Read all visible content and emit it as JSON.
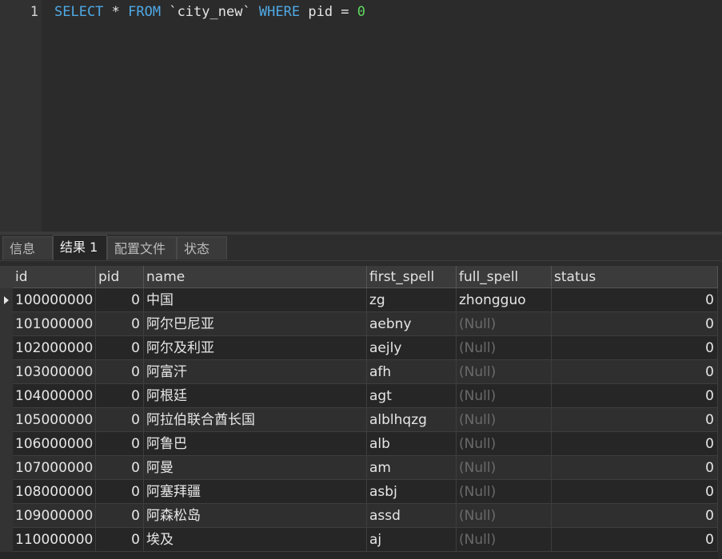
{
  "editor": {
    "line_number": "1",
    "tokens": {
      "select": "SELECT",
      "star": " * ",
      "from": "FROM",
      "table": " `city_new` ",
      "where": "WHERE",
      "cond": " pid = ",
      "value": "0"
    }
  },
  "tabs": [
    {
      "label": "信息",
      "active": false
    },
    {
      "label": "结果 1",
      "active": true
    },
    {
      "label": "配置文件",
      "active": false
    },
    {
      "label": "状态",
      "active": false
    }
  ],
  "grid": {
    "columns": [
      "id",
      "pid",
      "name",
      "first_spell",
      "full_spell",
      "status"
    ],
    "rows": [
      {
        "id": "100000000",
        "pid": "0",
        "name": "中国",
        "first_spell": "zg",
        "full_spell": "zhongguo",
        "status": "0"
      },
      {
        "id": "101000000",
        "pid": "0",
        "name": "阿尔巴尼亚",
        "first_spell": "aebny",
        "full_spell": "(Null)",
        "status": "0"
      },
      {
        "id": "102000000",
        "pid": "0",
        "name": "阿尔及利亚",
        "first_spell": "aejly",
        "full_spell": "(Null)",
        "status": "0"
      },
      {
        "id": "103000000",
        "pid": "0",
        "name": "阿富汗",
        "first_spell": "afh",
        "full_spell": "(Null)",
        "status": "0"
      },
      {
        "id": "104000000",
        "pid": "0",
        "name": "阿根廷",
        "first_spell": "agt",
        "full_spell": "(Null)",
        "status": "0"
      },
      {
        "id": "105000000",
        "pid": "0",
        "name": "阿拉伯联合酋长国",
        "first_spell": "alblhqzg",
        "full_spell": "(Null)",
        "status": "0"
      },
      {
        "id": "106000000",
        "pid": "0",
        "name": "阿鲁巴",
        "first_spell": "alb",
        "full_spell": "(Null)",
        "status": "0"
      },
      {
        "id": "107000000",
        "pid": "0",
        "name": "阿曼",
        "first_spell": "am",
        "full_spell": "(Null)",
        "status": "0"
      },
      {
        "id": "108000000",
        "pid": "0",
        "name": "阿塞拜疆",
        "first_spell": "asbj",
        "full_spell": "(Null)",
        "status": "0"
      },
      {
        "id": "109000000",
        "pid": "0",
        "name": "阿森松岛",
        "first_spell": "assd",
        "full_spell": "(Null)",
        "status": "0"
      },
      {
        "id": "110000000",
        "pid": "0",
        "name": "埃及",
        "first_spell": "aj",
        "full_spell": "(Null)",
        "status": "0"
      }
    ]
  }
}
